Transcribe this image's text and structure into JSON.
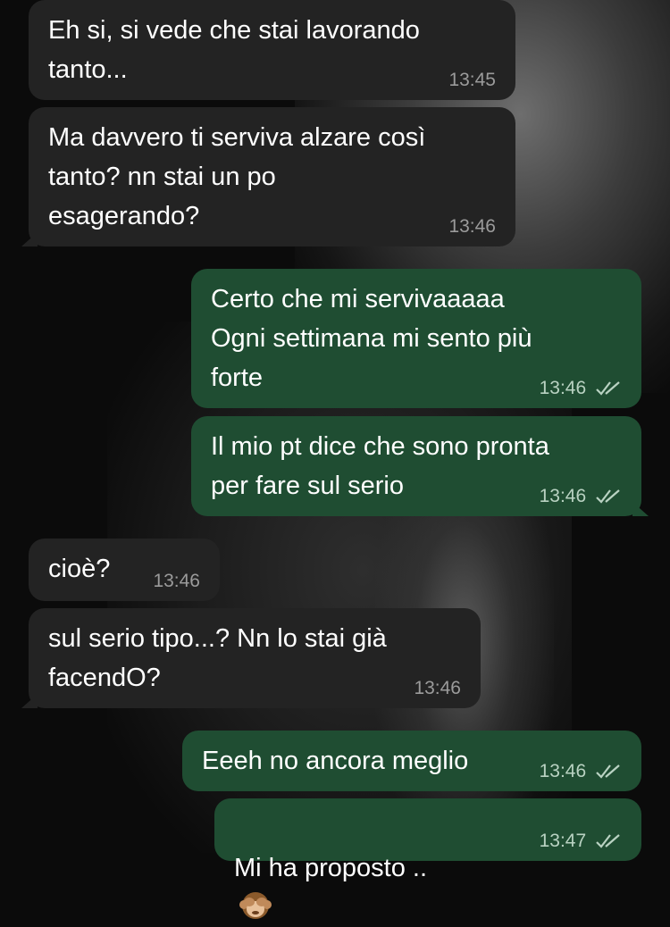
{
  "messages": [
    {
      "id": "m1",
      "dir": "in",
      "text": "Eh si, si vede che stai lavorando\ntanto...",
      "time": "13:45"
    },
    {
      "id": "m2",
      "dir": "in",
      "text": "Ma davvero ti serviva alzare così\ntanto? nn stai un po\nesagerando?",
      "time": "13:46"
    },
    {
      "id": "m3",
      "dir": "out",
      "text": "Certo che mi servivaaaaa\nOgni settimana mi sento più\nforte",
      "time": "13:46",
      "status": "read"
    },
    {
      "id": "m4",
      "dir": "out",
      "text": "Il mio pt dice che sono pronta\nper fare sul serio",
      "time": "13:46",
      "status": "read"
    },
    {
      "id": "m5",
      "dir": "in",
      "text": "cioè?",
      "time": "13:46"
    },
    {
      "id": "m6",
      "dir": "in",
      "text": "sul serio tipo...? Nn lo stai già\nfacendO?",
      "time": "13:46"
    },
    {
      "id": "m7",
      "dir": "out",
      "text": "Eeeh no ancora meglio",
      "time": "13:46",
      "status": "read"
    },
    {
      "id": "m8",
      "dir": "out",
      "text": "Mi ha proposto ..",
      "emoji": "see-no-evil-monkey",
      "time": "13:47",
      "status": "read"
    }
  ],
  "colors": {
    "incoming_bubble": "#232323",
    "outgoing_bubble": "#1f4d32",
    "text": "#ffffff",
    "timestamp": "#9b9b9b",
    "read_ticks": "#b9d2c2"
  }
}
